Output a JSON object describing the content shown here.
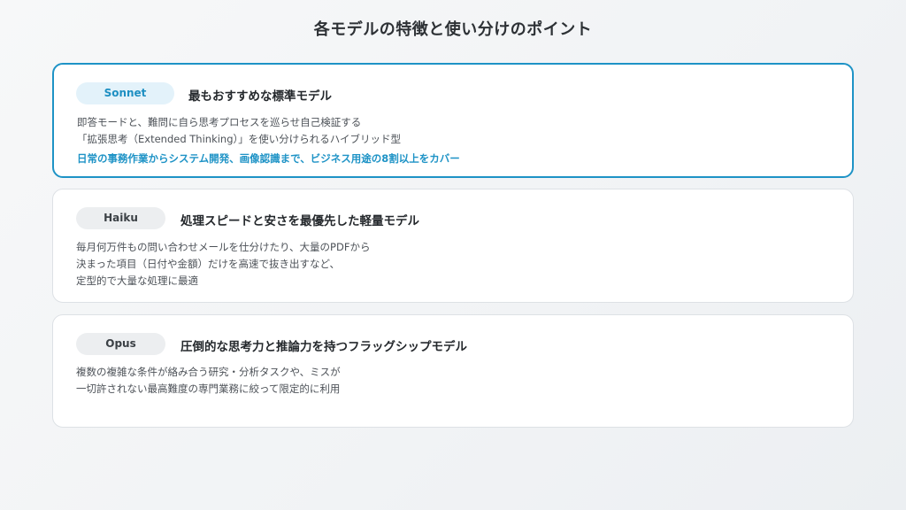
{
  "title": "各モデルの特徴と使い分けのポイント",
  "colors": {
    "accent": "#1e93c6",
    "badge_blue_bg": "#e3f2fa",
    "badge_gray_bg": "#eceef0",
    "text_dark": "#24282c",
    "text_body": "#4d5258"
  },
  "cards": [
    {
      "badge": "Sonnet",
      "heading": "最もおすすめな標準モデル",
      "lines": [
        "即答モードと、難問に自ら思考プロセスを巡らせ自己検証する",
        "「拡張思考（Extended Thinking）」を使い分けられるハイブリッド型"
      ],
      "emphasis": "日常の事務作業からシステム開発、画像認識まで、ビジネス用途の8割以上をカバー"
    },
    {
      "badge": "Haiku",
      "heading": "処理スピードと安さを最優先した軽量モデル",
      "lines": [
        "毎月何万件もの問い合わせメールを仕分けたり、大量のPDFから",
        "決まった項目（日付や金額）だけを高速で抜き出すなど、",
        "定型的で大量な処理に最適"
      ]
    },
    {
      "badge": "Opus",
      "heading": "圧倒的な思考力と推論力を持つフラッグシップモデル",
      "lines": [
        "複数の複雑な条件が絡み合う研究・分析タスクや、ミスが",
        "一切許されない最高難度の専門業務に絞って限定的に利用"
      ]
    }
  ]
}
